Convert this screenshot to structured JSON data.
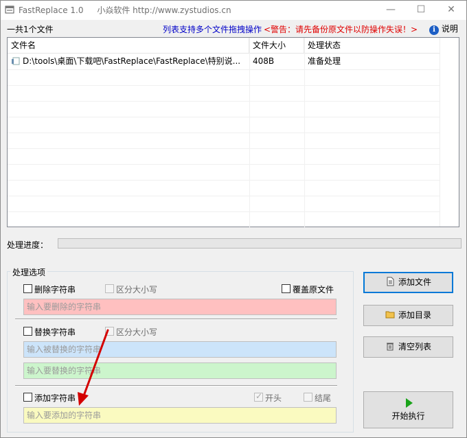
{
  "window": {
    "title": "FastReplace 1.0",
    "vendor": "小焱软件 http://www.zystudios.cn",
    "controls": {
      "minimize": "—",
      "maximize": "☐",
      "close": "✕"
    }
  },
  "header": {
    "file_count": "一共1个文件",
    "drag_hint": "列表支持多个文件拖拽操作",
    "warning": "<警告：请先备份原文件以防操作失误！>",
    "help_label": "说明"
  },
  "table": {
    "columns": [
      "文件名",
      "文件大小",
      "处理状态"
    ],
    "rows": [
      {
        "name": "D:\\tools\\桌面\\下载吧\\FastReplace\\FastReplace\\特别说...",
        "size": "408B",
        "status": "准备处理"
      }
    ]
  },
  "progress": {
    "label": "处理进度：",
    "value_percent": 0
  },
  "options": {
    "group_title": "处理选项",
    "delete": {
      "label": "删除字符串",
      "case_label": "区分大小写",
      "overwrite_label": "覆盖原文件",
      "placeholder": "输入要删除的字符串",
      "color": "#ffc0c0"
    },
    "replace": {
      "label": "替换字符串",
      "case_label": "区分大小写",
      "from_placeholder": "输入被替换的字符串",
      "from_color": "#cce4fa",
      "to_placeholder": "输入要替换的字符串",
      "to_color": "#ccf5cc"
    },
    "add": {
      "label": "添加字符串",
      "start_label": "开头",
      "end_label": "结尾",
      "placeholder": "输入要添加的字符串",
      "color": "#fafac0"
    }
  },
  "buttons": {
    "add_file": "添加文件",
    "add_dir": "添加目录",
    "clear_list": "清空列表",
    "start": "开始执行"
  }
}
